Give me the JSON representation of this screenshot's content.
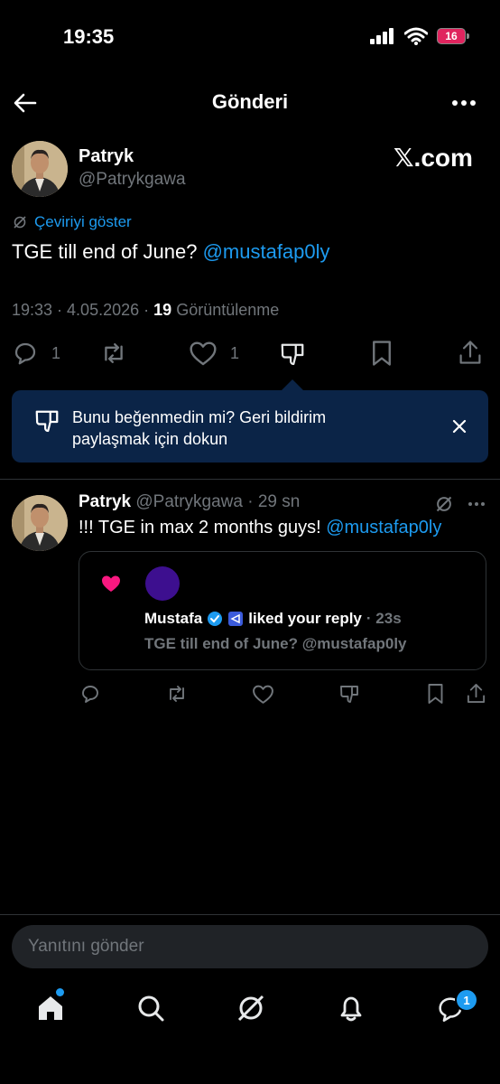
{
  "status_bar": {
    "time": "19:35",
    "battery": "16"
  },
  "header": {
    "title": "Gönderi"
  },
  "post": {
    "author_name": "Patryk",
    "author_handle": "@Patrykgawa",
    "brand": "𝕏.com",
    "translate_label": "Çeviriyi göster",
    "text": "TGE till end of June?",
    "mention": "@mustafap0ly",
    "timestamp": "19:33 · 4.05.2026 ·",
    "views_count": "19",
    "views_label": "Görüntülenme",
    "reply_count": "1",
    "like_count": "1"
  },
  "feedback_banner": {
    "line1": "Bunu beğenmedin mi? Geri bildirim",
    "line2": "paylaşmak için dokun"
  },
  "reply": {
    "author_name": "Patryk",
    "author_handle": "@Patrykgawa",
    "time": "· 29 sn",
    "text": "!!! TGE in max 2 months guys!",
    "mention": "@mustafap0ly",
    "embed": {
      "name": "Mustafa",
      "action": "liked your reply",
      "time": "· 23s",
      "quote": "TGE till end of June? @mustafap0ly"
    }
  },
  "composer": {
    "placeholder": "Yanıtını gönder"
  },
  "bottom_nav": {
    "messages_badge": "1"
  },
  "colors": {
    "accent": "#1d9bf0",
    "banner": "#0b2447",
    "like": "#f91880",
    "muted": "#71767b"
  }
}
